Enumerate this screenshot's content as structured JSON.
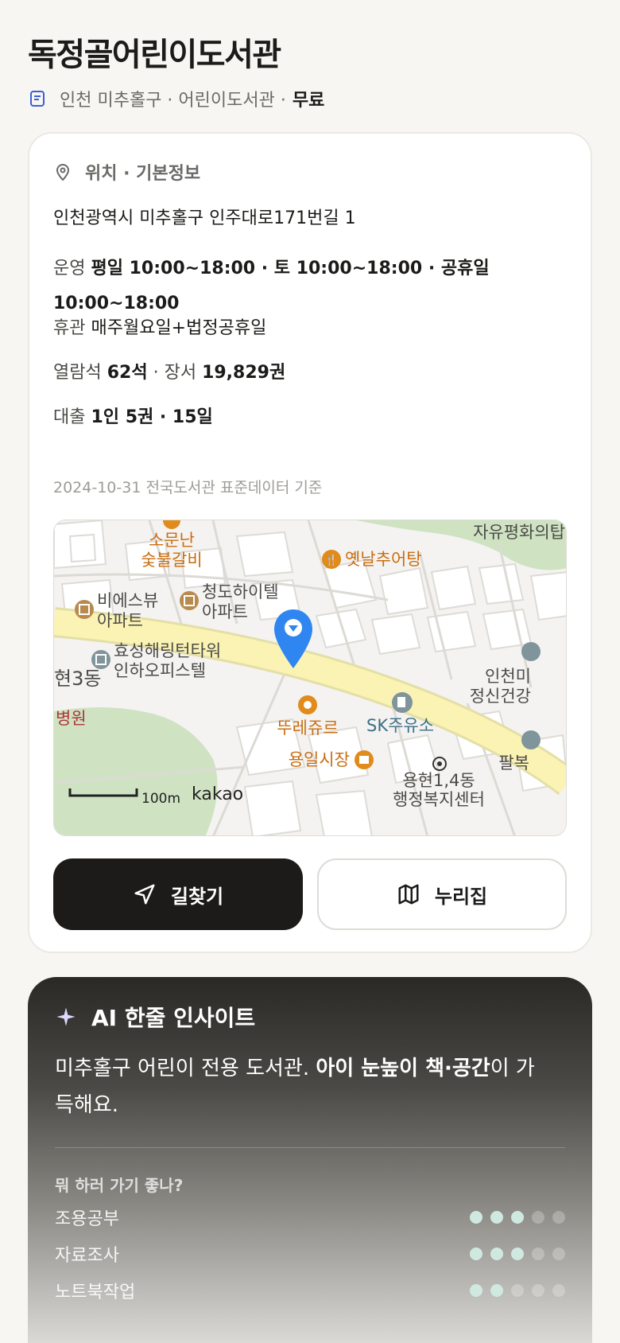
{
  "title": "독정골어린이도서관",
  "subtitle": {
    "icon": "document-icon",
    "region": "인천 미추홀구 · 어린이도서관 ·",
    "fee": "무료"
  },
  "info": {
    "section_icon": "location-pin-icon",
    "section_title": "위치 · 기본정보",
    "address": "인천광역시 미추홀구 인주대로171번길 1",
    "hours_label": "운영",
    "hours_value": "평일 10:00~18:00 · 토 10:00~18:00 · 공휴일 10:00~18:00",
    "closed_label": "휴관",
    "closed_value": "매주월요일+법정공휴일",
    "seats_label": "열람석",
    "seats_value": "62석",
    "books_label": "· 장서",
    "books_value": "19,829권",
    "loan_label": "대출",
    "loan_value": "1인 5권 · 15일",
    "source": "2024-10-31 전국도서관 표준데이터 기준"
  },
  "map": {
    "pin_color": "#2f86f0",
    "labels": {
      "p1": "소문난",
      "p1b": "숯불갈비",
      "p2": "자유평화의탑",
      "p3": "옛날추어탕",
      "p4": "비에스뷰",
      "p4b": "아파트",
      "p5": "청도하이텔",
      "p5b": "아파트",
      "p6": "효성해링턴타워",
      "p6b": "인하오피스텔",
      "p7": "현3동",
      "p8": "병원",
      "p9": "인천미",
      "p9b": "정신건강",
      "p10": "SK주유소",
      "p11": "뚜레쥬르",
      "p12": "용일시장",
      "p13": "팔복",
      "p14": "용현1,4동",
      "p14b": "행정복지센터"
    },
    "scale": "100m",
    "brand": "kakao"
  },
  "buttons": {
    "route_label": "길찾기",
    "route_icon": "navigation-arrow-icon",
    "nuri_label": "누리집",
    "nuri_icon": "map-icon"
  },
  "ai": {
    "icon": "sparkle-icon",
    "title": "AI 한줄 인사이트",
    "text_plain": "미추홀구 어린이 전용 도서관.",
    "text_bold": "아이 눈높이 책·공간",
    "text_tail": "이 가득해요.",
    "question": "뭐 하러 가기 좋나?",
    "ratings": [
      {
        "name": "조용공부",
        "score": 3,
        "max": 5
      },
      {
        "name": "자료조사",
        "score": 3,
        "max": 5
      },
      {
        "name": "노트북작업",
        "score": 2,
        "max": 5
      }
    ]
  }
}
